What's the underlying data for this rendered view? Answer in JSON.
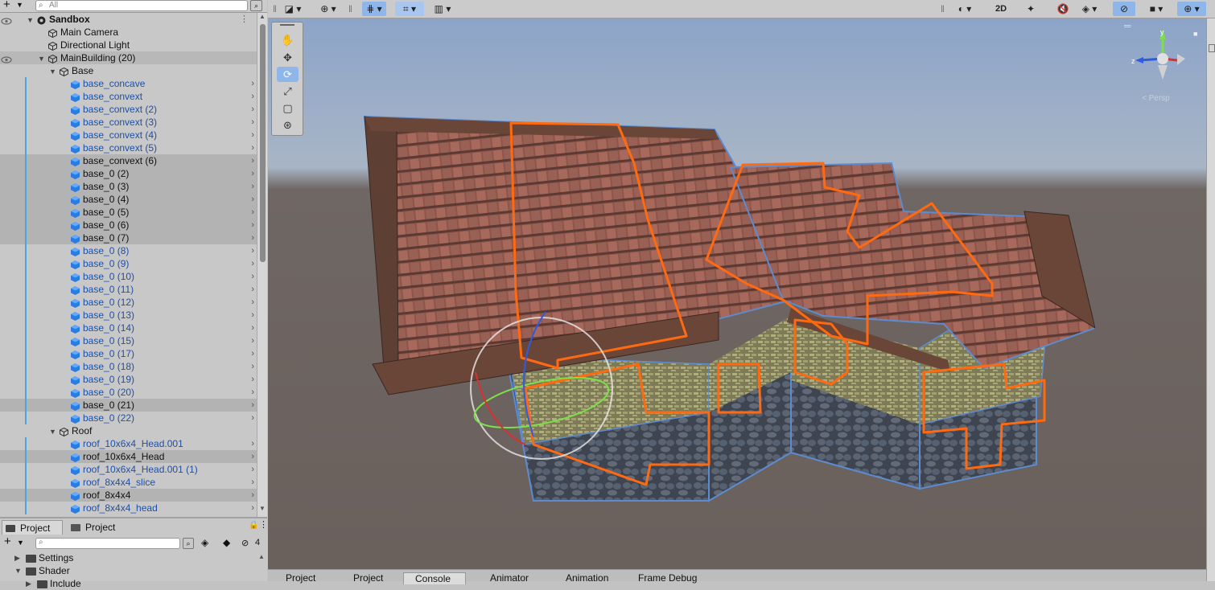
{
  "hierarchy": {
    "search_placeholder": "All",
    "rows": [
      {
        "label": "Sandbox",
        "indent": 0,
        "kind": "scene",
        "fold": "open",
        "bold": true
      },
      {
        "label": "Main Camera",
        "indent": 1,
        "kind": "obj"
      },
      {
        "label": "Directional Light",
        "indent": 1,
        "kind": "obj"
      },
      {
        "label": "MainBuilding (20)",
        "indent": 1,
        "kind": "obj",
        "fold": "open",
        "sel": true
      },
      {
        "label": "Base",
        "indent": 2,
        "kind": "obj",
        "fold": "open"
      },
      {
        "label": "base_concave",
        "indent": 3,
        "kind": "prefab"
      },
      {
        "label": "base_convext",
        "indent": 3,
        "kind": "prefab"
      },
      {
        "label": "base_convext (2)",
        "indent": 3,
        "kind": "prefab"
      },
      {
        "label": "base_convext (3)",
        "indent": 3,
        "kind": "prefab"
      },
      {
        "label": "base_convext (4)",
        "indent": 3,
        "kind": "prefab"
      },
      {
        "label": "base_convext (5)",
        "indent": 3,
        "kind": "prefab"
      },
      {
        "label": "base_convext (6)",
        "indent": 3,
        "kind": "prefab",
        "sel": true,
        "dark": true
      },
      {
        "label": "base_0 (2)",
        "indent": 3,
        "kind": "prefab",
        "sel": true,
        "dark": true
      },
      {
        "label": "base_0 (3)",
        "indent": 3,
        "kind": "prefab",
        "sel": true,
        "dark": true
      },
      {
        "label": "base_0 (4)",
        "indent": 3,
        "kind": "prefab",
        "sel": true,
        "dark": true
      },
      {
        "label": "base_0 (5)",
        "indent": 3,
        "kind": "prefab",
        "sel": true,
        "dark": true
      },
      {
        "label": "base_0 (6)",
        "indent": 3,
        "kind": "prefab",
        "sel": true,
        "dark": true
      },
      {
        "label": "base_0 (7)",
        "indent": 3,
        "kind": "prefab",
        "sel": true,
        "dark": true
      },
      {
        "label": "base_0 (8)",
        "indent": 3,
        "kind": "prefab"
      },
      {
        "label": "base_0 (9)",
        "indent": 3,
        "kind": "prefab"
      },
      {
        "label": "base_0 (10)",
        "indent": 3,
        "kind": "prefab"
      },
      {
        "label": "base_0 (11)",
        "indent": 3,
        "kind": "prefab"
      },
      {
        "label": "base_0 (12)",
        "indent": 3,
        "kind": "prefab"
      },
      {
        "label": "base_0 (13)",
        "indent": 3,
        "kind": "prefab"
      },
      {
        "label": "base_0 (14)",
        "indent": 3,
        "kind": "prefab"
      },
      {
        "label": "base_0 (15)",
        "indent": 3,
        "kind": "prefab"
      },
      {
        "label": "base_0 (17)",
        "indent": 3,
        "kind": "prefab"
      },
      {
        "label": "base_0 (18)",
        "indent": 3,
        "kind": "prefab"
      },
      {
        "label": "base_0 (19)",
        "indent": 3,
        "kind": "prefab"
      },
      {
        "label": "base_0 (20)",
        "indent": 3,
        "kind": "prefab"
      },
      {
        "label": "base_0 (21)",
        "indent": 3,
        "kind": "prefab",
        "sel": true,
        "dark": true
      },
      {
        "label": "base_0 (22)",
        "indent": 3,
        "kind": "prefab"
      },
      {
        "label": "Roof",
        "indent": 2,
        "kind": "obj",
        "fold": "open"
      },
      {
        "label": "roof_10x6x4_Head.001",
        "indent": 3,
        "kind": "prefab"
      },
      {
        "label": "roof_10x6x4_Head",
        "indent": 3,
        "kind": "prefab",
        "sel": true,
        "dark": true
      },
      {
        "label": "roof_10x6x4_Head.001 (1)",
        "indent": 3,
        "kind": "prefab"
      },
      {
        "label": "roof_8x4x4_slice",
        "indent": 3,
        "kind": "prefab"
      },
      {
        "label": "roof_8x4x4",
        "indent": 3,
        "kind": "prefab",
        "sel": true,
        "dark": true
      },
      {
        "label": "roof_8x4x4_head",
        "indent": 3,
        "kind": "prefab"
      }
    ]
  },
  "project": {
    "tabs": [
      "Project",
      "Project"
    ],
    "hidden_count": "4",
    "folders": [
      {
        "label": "Settings",
        "fold": "closed"
      },
      {
        "label": "Shader",
        "fold": "open"
      },
      {
        "label": "Include",
        "fold": "closed"
      }
    ]
  },
  "scene_toolbar": {
    "mode_2d": "2D",
    "iso_label": "Persp"
  },
  "bottom_tabs": [
    "Project",
    "Project",
    "Console",
    "Animator",
    "Animation",
    "Frame Debug"
  ],
  "colors": {
    "selection_outline": "#ff6a10",
    "prefab_text": "#1f4fa6",
    "tool_active": "#8fb6e8"
  }
}
